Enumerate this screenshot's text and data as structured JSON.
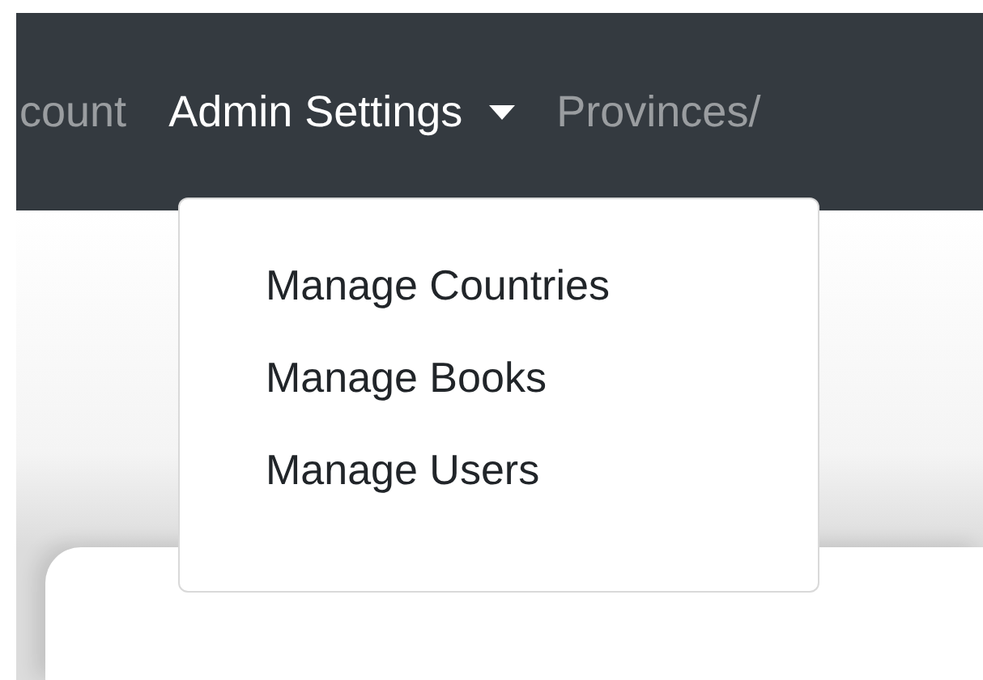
{
  "navbar": {
    "items": [
      {
        "label": "count",
        "kind": "link",
        "active": false
      },
      {
        "label": "Admin Settings",
        "kind": "dropdown",
        "active": true,
        "expanded": true,
        "menu": [
          {
            "label": "Manage Countries"
          },
          {
            "label": "Manage Books"
          },
          {
            "label": "Manage Users"
          }
        ]
      },
      {
        "label": "Provinces/",
        "kind": "link",
        "active": false
      }
    ]
  }
}
